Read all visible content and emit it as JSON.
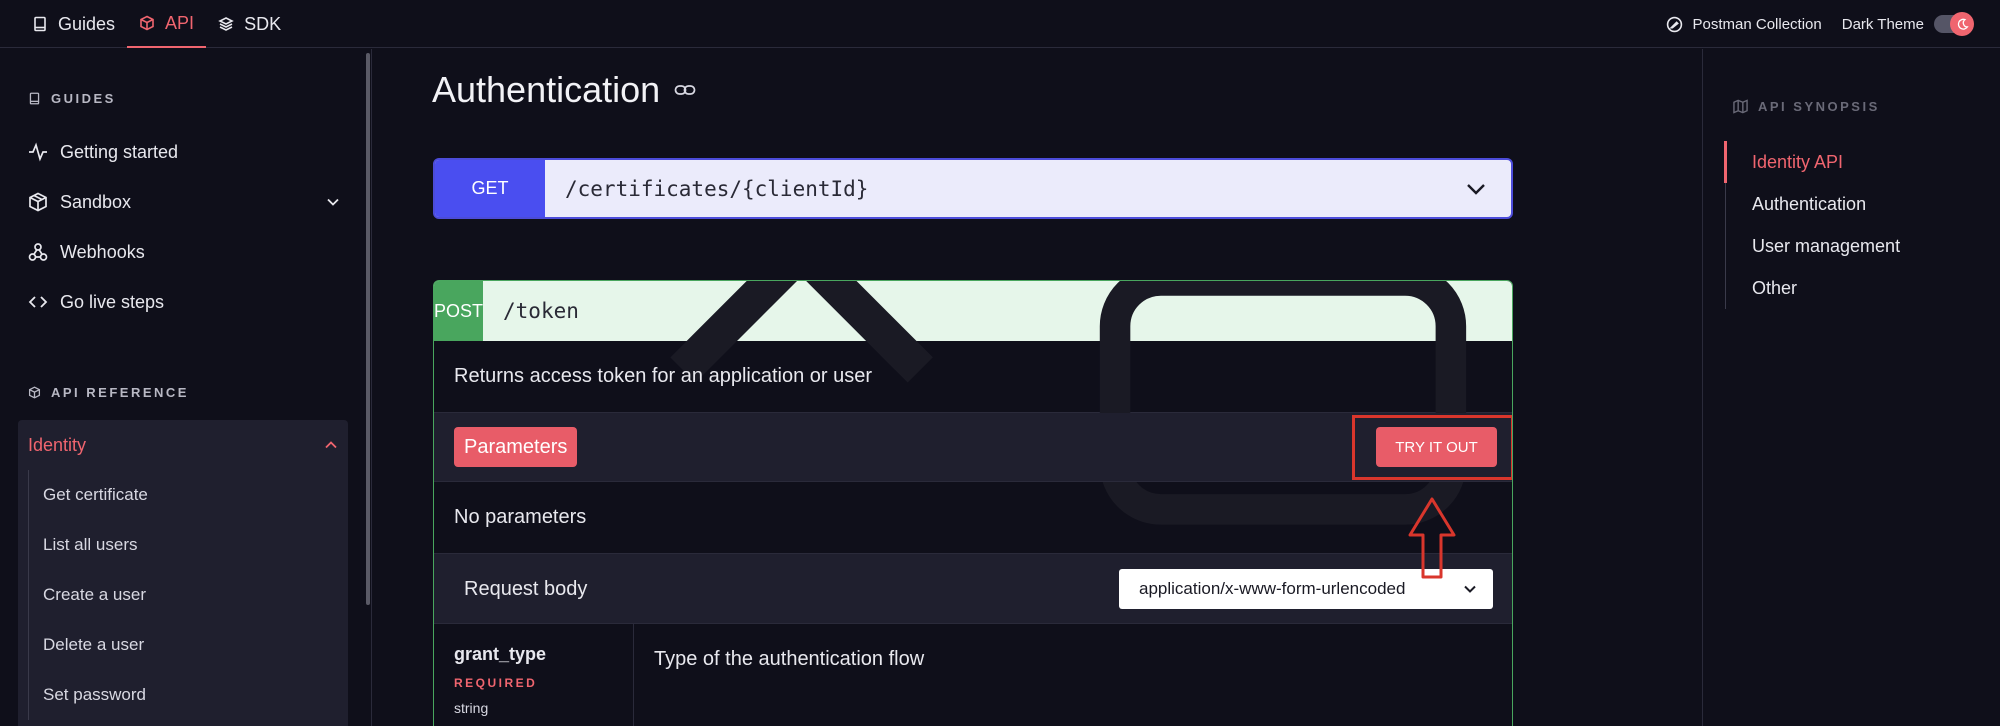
{
  "topbar": {
    "tabs": [
      {
        "label": "Guides",
        "icon": "book-icon"
      },
      {
        "label": "API",
        "icon": "cube-icon",
        "active": true
      },
      {
        "label": "SDK",
        "icon": "layers-icon"
      }
    ],
    "postman_label": "Postman Collection",
    "theme_label": "Dark Theme"
  },
  "sidebar": {
    "guides_heading": "GUIDES",
    "guides": [
      {
        "label": "Getting started",
        "icon": "activity-icon"
      },
      {
        "label": "Sandbox",
        "icon": "box-icon"
      },
      {
        "label": "Webhooks",
        "icon": "webhook-icon"
      },
      {
        "label": "Go live steps",
        "icon": "code-icon"
      }
    ],
    "api_heading": "API REFERENCE",
    "group": {
      "title": "Identity",
      "items": [
        "Get certificate",
        "List all users",
        "Create a user",
        "Delete a user",
        "Set password"
      ]
    }
  },
  "main": {
    "title": "Authentication",
    "get_op": {
      "verb": "GET",
      "path": "/certificates/{clientId}"
    },
    "post_op": {
      "verb": "POST",
      "path": "/token",
      "description": "Returns access token for an application or user",
      "parameters_label": "Parameters",
      "try_label": "TRY IT OUT",
      "no_params": "No parameters",
      "request_body_label": "Request body",
      "content_type": "application/x-www-form-urlencoded",
      "param": {
        "name": "grant_type",
        "required": "REQUIRED",
        "type": "string",
        "description": "Type of the authentication flow"
      }
    }
  },
  "synopsis": {
    "heading": "API SYNOPSIS",
    "items": [
      "Identity API",
      "Authentication",
      "User management",
      "Other"
    ],
    "active_index": 0
  },
  "colors": {
    "accent": "#f0656f",
    "get": "#4a4ef0",
    "post": "#49a65e",
    "highlight": "#d9362c"
  }
}
